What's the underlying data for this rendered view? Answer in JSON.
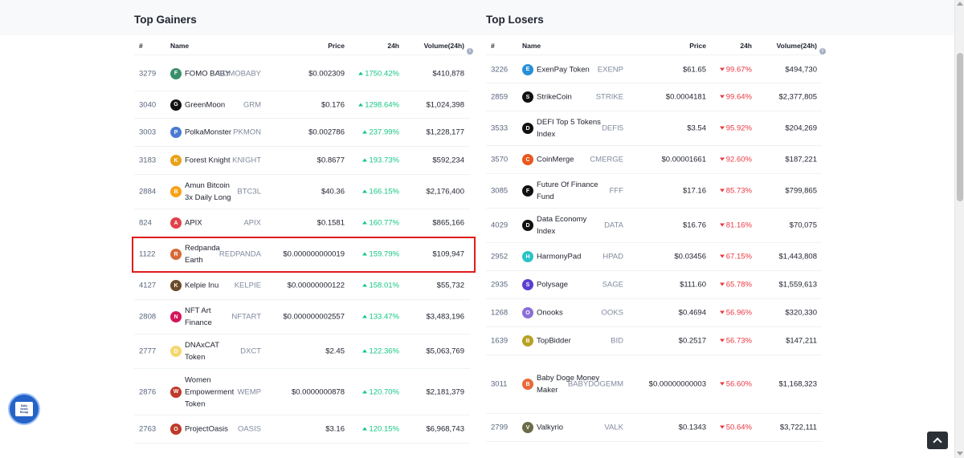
{
  "gainers": {
    "title": "Top Gainers",
    "headers": {
      "rank": "#",
      "name": "Name",
      "price": "Price",
      "change": "24h",
      "volume": "Volume(24h)"
    },
    "rows": [
      {
        "rank": "3279",
        "name": "FOMO BABY",
        "symbol": "FOMOBABY",
        "price": "$0.002309",
        "change": "1750.42%",
        "volume": "$410,878",
        "icon_color": "#3a8f6a",
        "icon": "fomobaby-icon"
      },
      {
        "rank": "3040",
        "name": "GreenMoon",
        "symbol": "GRM",
        "price": "$0.176",
        "change": "1298.64%",
        "volume": "$1,024,398",
        "icon_color": "#111111",
        "icon": "greenmoon-icon"
      },
      {
        "rank": "3003",
        "name": "PolkaMonster",
        "symbol": "PKMON",
        "price": "$0.002786",
        "change": "237.99%",
        "volume": "$1,228,177",
        "icon_color": "#4a7bd0",
        "icon": "polkamonster-icon"
      },
      {
        "rank": "3183",
        "name": "Forest Knight",
        "symbol": "KNIGHT",
        "price": "$0.8677",
        "change": "193.73%",
        "volume": "$592,234",
        "icon_color": "#e8a21a",
        "icon": "forestknight-icon"
      },
      {
        "rank": "2884",
        "name": "Amun Bitcoin 3x Daily Long",
        "symbol": "BTC3L",
        "price": "$40.36",
        "change": "166.15%",
        "volume": "$2,176,400",
        "icon_color": "#f7a318",
        "icon": "amun-bitcoin-icon"
      },
      {
        "rank": "824",
        "name": "APIX",
        "symbol": "APIX",
        "price": "$0.1581",
        "change": "160.77%",
        "volume": "$865,166",
        "icon_color": "#e0424a",
        "icon": "apix-icon"
      },
      {
        "rank": "1122",
        "name": "Redpanda Earth",
        "symbol": "REDPANDA",
        "price": "$0.000000000019",
        "change": "159.79%",
        "volume": "$109,947",
        "icon_color": "#d66a3a",
        "icon": "redpanda-icon"
      },
      {
        "rank": "4127",
        "name": "Kelpie Inu",
        "symbol": "KELPIE",
        "price": "$0.00000000122",
        "change": "158.01%",
        "volume": "$55,732",
        "icon_color": "#6b4a2a",
        "icon": "kelpie-icon"
      },
      {
        "rank": "2808",
        "name": "NFT Art Finance",
        "symbol": "NFTART",
        "price": "$0.000000002557",
        "change": "133.47%",
        "volume": "$3,483,196",
        "icon_color": "#d4145a",
        "icon": "nftart-icon"
      },
      {
        "rank": "2777",
        "name": "DNAxCAT Token",
        "symbol": "DXCT",
        "price": "$2.45",
        "change": "122.36%",
        "volume": "$5,063,769",
        "icon_color": "#f5d76e",
        "icon": "dnaxcat-icon"
      },
      {
        "rank": "2876",
        "name": "Women Empowerment Token",
        "symbol": "WEMP",
        "price": "$0.0000000878",
        "change": "120.70%",
        "volume": "$2,181,379",
        "icon_color": "#c0392b",
        "icon": "wemp-icon"
      },
      {
        "rank": "2763",
        "name": "ProjectOasis",
        "symbol": "OASIS",
        "price": "$3.16",
        "change": "120.15%",
        "volume": "$6,968,743",
        "icon_color": "#c0392b",
        "icon": "oasis-icon"
      }
    ]
  },
  "losers": {
    "title": "Top Losers",
    "headers": {
      "rank": "#",
      "name": "Name",
      "price": "Price",
      "change": "24h",
      "volume": "Volume(24h)"
    },
    "rows": [
      {
        "rank": "3226",
        "name": "ExenPay Token",
        "symbol": "EXENP",
        "price": "$61.65",
        "change": "99.67%",
        "volume": "$494,730",
        "icon_color": "#2a8fd6",
        "icon": "exenpay-icon"
      },
      {
        "rank": "2859",
        "name": "StrikeCoin",
        "symbol": "STRIKE",
        "price": "$0.0004181",
        "change": "99.64%",
        "volume": "$2,377,805",
        "icon_color": "#111111",
        "icon": "strikecoin-icon"
      },
      {
        "rank": "3533",
        "name": "DEFI Top 5 Tokens Index",
        "symbol": "DEFI5",
        "price": "$3.54",
        "change": "95.92%",
        "volume": "$204,269",
        "icon_color": "#111111",
        "icon": "defi5-icon"
      },
      {
        "rank": "3570",
        "name": "CoinMerge",
        "symbol": "CMERGE",
        "price": "$0.00001661",
        "change": "92.60%",
        "volume": "$187,221",
        "icon_color": "#e8571e",
        "icon": "coinmerge-icon"
      },
      {
        "rank": "3085",
        "name": "Future Of Finance Fund",
        "symbol": "FFF",
        "price": "$17.16",
        "change": "85.73%",
        "volume": "$799,865",
        "icon_color": "#111111",
        "icon": "fff-icon"
      },
      {
        "rank": "4029",
        "name": "Data Economy Index",
        "symbol": "DATA",
        "price": "$16.76",
        "change": "81.16%",
        "volume": "$70,075",
        "icon_color": "#111111",
        "icon": "data-icon"
      },
      {
        "rank": "2952",
        "name": "HarmonyPad",
        "symbol": "HPAD",
        "price": "$0.03456",
        "change": "67.15%",
        "volume": "$1,443,808",
        "icon_color": "#2ac3c7",
        "icon": "harmonypad-icon"
      },
      {
        "rank": "2935",
        "name": "Polysage",
        "symbol": "SAGE",
        "price": "$111.60",
        "change": "65.78%",
        "volume": "$1,559,613",
        "icon_color": "#5b3fd0",
        "icon": "polysage-icon"
      },
      {
        "rank": "1268",
        "name": "Onooks",
        "symbol": "OOKS",
        "price": "$0.4694",
        "change": "56.96%",
        "volume": "$320,330",
        "icon_color": "#8a6fd8",
        "icon": "onooks-icon"
      },
      {
        "rank": "1639",
        "name": "TopBidder",
        "symbol": "BID",
        "price": "$0.2517",
        "change": "56.73%",
        "volume": "$147,211",
        "icon_color": "#b8a020",
        "icon": "topbidder-icon"
      },
      {
        "rank": "3011",
        "name": "Baby Doge Money Maker",
        "symbol": "BABYDOGEMM",
        "price": "$0.00000000003",
        "change": "56.60%",
        "volume": "$1,168,323",
        "icon_color": "#e86a3a",
        "icon": "babydogemm-icon"
      },
      {
        "rank": "2799",
        "name": "Valkyrio",
        "symbol": "VALK",
        "price": "$0.1343",
        "change": "50.64%",
        "volume": "$3,722,111",
        "icon_color": "#6b6b4a",
        "icon": "valkyrio-icon"
      }
    ]
  },
  "badge": {
    "line1": "Daily",
    "line2": "News",
    "line3": "Recap"
  }
}
